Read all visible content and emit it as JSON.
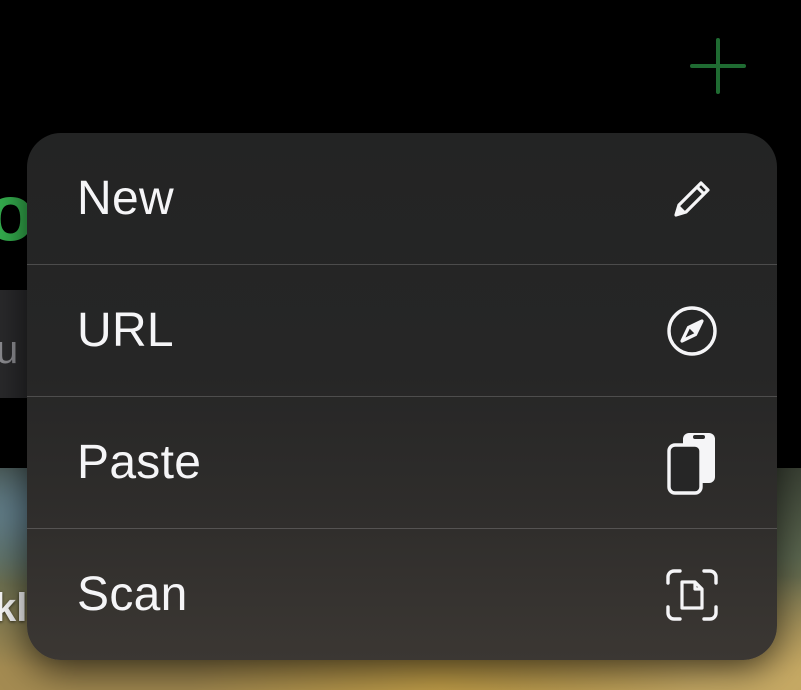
{
  "background": {
    "title_fragment": "o",
    "search_fragment": "u",
    "photo_caption_fragment": "kl",
    "accent_color": "#35b14f"
  },
  "menu": {
    "items": [
      {
        "label": "New",
        "icon": "pencil-icon"
      },
      {
        "label": "URL",
        "icon": "compass-icon"
      },
      {
        "label": "Paste",
        "icon": "clipboard-icon"
      },
      {
        "label": "Scan",
        "icon": "document-scanner-icon"
      }
    ]
  },
  "colors": {
    "menu_background": "#262626",
    "menu_text": "#f5f5f7",
    "accent": "#35b14f"
  }
}
